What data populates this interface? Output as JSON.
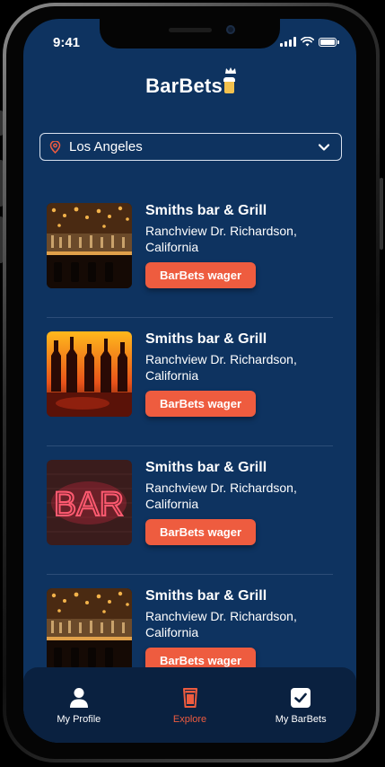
{
  "status_bar": {
    "time": "9:41"
  },
  "app": {
    "logo_text": "BarBets",
    "colors": {
      "background": "#0e3360",
      "accent": "#ee5c3f",
      "logo_mug": "#f2c14e",
      "tabbar": "#0a2140"
    }
  },
  "location": {
    "value": "Los Angeles",
    "icon": "location-pin-icon"
  },
  "bars": [
    {
      "name": "Smiths bar & Grill",
      "address": "Ranchview Dr. Richardson, California",
      "button_label": "BarBets wager",
      "image": "bar-interior-image"
    },
    {
      "name": "Smiths bar & Grill",
      "address": "Ranchview Dr. Richardson, California",
      "button_label": "BarBets wager",
      "image": "bottles-image"
    },
    {
      "name": "Smiths bar & Grill",
      "address": "Ranchview Dr. Richardson, California",
      "button_label": "BarBets wager",
      "image": "neon-bar-sign-image",
      "sign_text": "BAR"
    },
    {
      "name": "Smiths bar & Grill",
      "address": "Ranchview Dr. Richardson, California",
      "button_label": "BarBets wager",
      "image": "bar-interior-image"
    }
  ],
  "tabbar": {
    "tabs": [
      {
        "label": "My Profile",
        "icon": "user-icon",
        "active": false
      },
      {
        "label": "Explore",
        "icon": "beer-glass-icon",
        "active": true
      },
      {
        "label": "My BarBets",
        "icon": "checkbox-icon",
        "active": false
      }
    ]
  }
}
